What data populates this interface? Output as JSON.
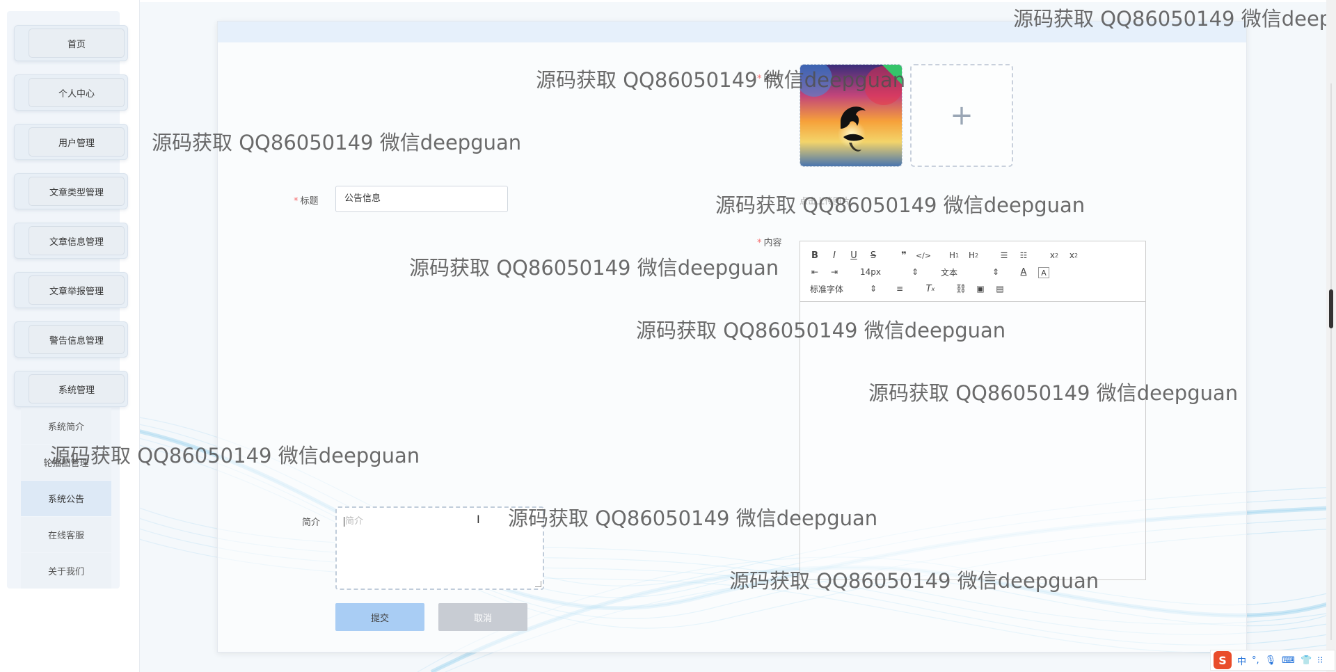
{
  "sidebar": {
    "items": [
      {
        "label": "首页"
      },
      {
        "label": "个人中心"
      },
      {
        "label": "用户管理"
      },
      {
        "label": "文章类型管理"
      },
      {
        "label": "文章信息管理"
      },
      {
        "label": "文章举报管理"
      },
      {
        "label": "警告信息管理"
      },
      {
        "label": "系统管理"
      }
    ],
    "submenu": [
      {
        "label": "系统简介"
      },
      {
        "label": "轮播图管理"
      },
      {
        "label": "系统公告"
      },
      {
        "label": "在线客服"
      },
      {
        "label": "关于我们"
      }
    ]
  },
  "form": {
    "image_label": "图片",
    "upload_tip": "点击上传图片",
    "title_label": "标题",
    "title_value": "公告信息",
    "content_label": "内容",
    "summary_label": "简介",
    "summary_placeholder": "简介",
    "submit_label": "提交",
    "cancel_label": "取消"
  },
  "editor": {
    "font_size": "14px",
    "block_type": "文本",
    "font_family": "标准字体"
  },
  "watermark": "源码获取 QQ86050149 微信deepguan",
  "watermark_cut": "源码获取 QQ86050149 微信deep",
  "ime": {
    "logo": "S",
    "lang": "中"
  }
}
